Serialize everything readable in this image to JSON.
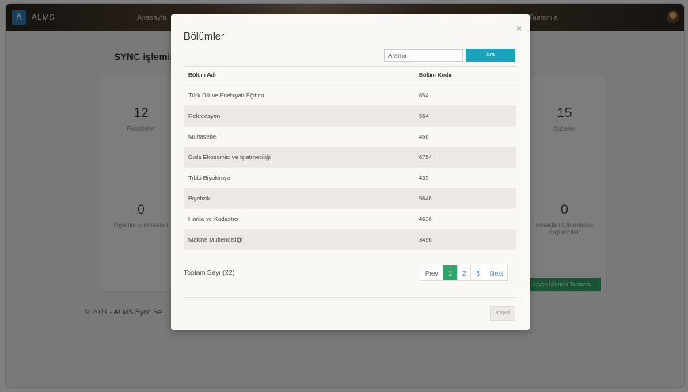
{
  "navbar": {
    "logo": "Λ",
    "brand": "ALMS",
    "links": [
      "Anasayfa",
      "Tamamla"
    ]
  },
  "page": {
    "title": "SYNC işlemini ta",
    "stats": [
      {
        "value": "12",
        "label": "Fakülteler"
      },
      {
        "value": "15",
        "label": "Şubeler"
      },
      {
        "value": "0",
        "label": "Öğretim Elemanları"
      },
      {
        "value": "0",
        "label": "oslardan Çıkarılacak Öğrenciler"
      }
    ],
    "green_button": "eşyon İşlemini Tamamla",
    "footer": "© 2021 - ALMS Sync Se"
  },
  "modal": {
    "title": "Bölümler",
    "search_placeholder": "Arama",
    "search_button": "Ara",
    "columns": [
      "Bölüm Adı",
      "Bölüm Kodu"
    ],
    "rows": [
      {
        "name": "Türk Dili ve Edebiyatı Eğitimi",
        "code": "654"
      },
      {
        "name": "Rekreasyon",
        "code": "564"
      },
      {
        "name": "Muhasebe",
        "code": "456"
      },
      {
        "name": "Gıda Ekonomisi ve İşletmeciliği",
        "code": "6754"
      },
      {
        "name": "Tıbbi Biyokimya",
        "code": "435"
      },
      {
        "name": "Biyofizik",
        "code": "5646"
      },
      {
        "name": "Harita ve Kadastro",
        "code": "4636"
      },
      {
        "name": "Makine Mühendisliği",
        "code": "3456"
      }
    ],
    "total": "Toplam Sayı (22)",
    "pagination": {
      "prev": "Prev",
      "pages": [
        "1",
        "2",
        "3"
      ],
      "next": "Next"
    },
    "close_label": "Kapat",
    "close_icon": "×"
  }
}
